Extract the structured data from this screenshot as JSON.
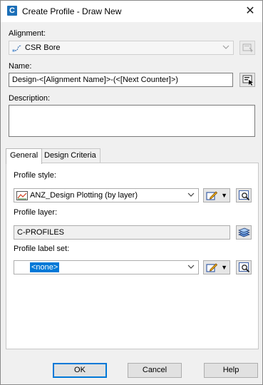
{
  "window": {
    "title": "Create Profile - Draw New",
    "app_icon_letter": "C",
    "close_glyph": "✕"
  },
  "alignment": {
    "label": "Alignment:",
    "value": "CSR Bore",
    "icon": "alignment-icon",
    "pick_icon": "pick-from-drawing-icon"
  },
  "name": {
    "label": "Name:",
    "value": "Design-<[Alignment Name]>-(<[Next Counter]>)",
    "edit_icon": "name-template-icon"
  },
  "description": {
    "label": "Description:",
    "value": ""
  },
  "tabs": [
    {
      "label": "General",
      "active": true
    },
    {
      "label": "Design Criteria",
      "active": false
    }
  ],
  "general": {
    "profile_style_label": "Profile style:",
    "profile_style_value": "ANZ_Design Plotting (by layer)",
    "profile_layer_label": "Profile layer:",
    "profile_layer_value": "C-PROFILES",
    "profile_label_set_label": "Profile label set:",
    "profile_label_set_value": "<none>"
  },
  "buttons": {
    "ok": "OK",
    "cancel": "Cancel",
    "help": "Help"
  },
  "colors": {
    "accent": "#0078d7",
    "selection": "#0078d7"
  }
}
